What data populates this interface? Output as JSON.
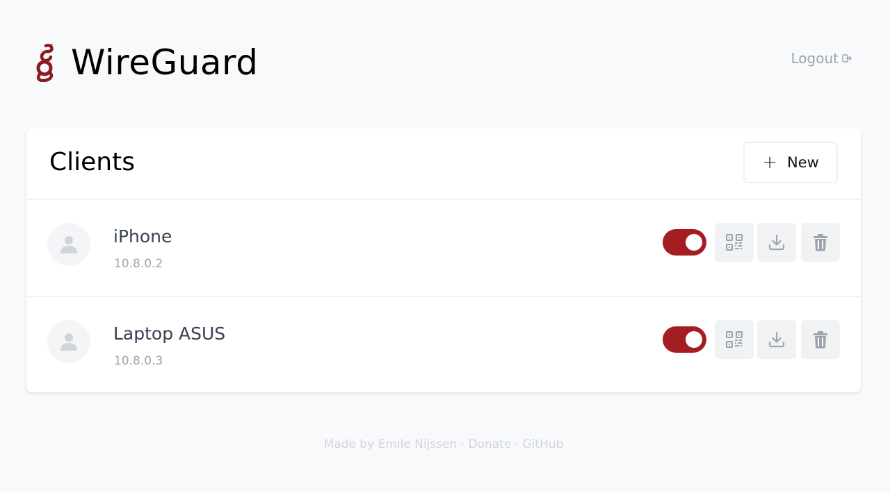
{
  "header": {
    "brand_title": "WireGuard",
    "logout_label": "Logout"
  },
  "clients_card": {
    "title": "Clients",
    "new_button_icon": "+",
    "new_button_label": "New",
    "clients": [
      {
        "name": "iPhone",
        "address": "10.8.0.2",
        "enabled": true
      },
      {
        "name": "Laptop ASUS",
        "address": "10.8.0.3",
        "enabled": true
      }
    ]
  },
  "footer": {
    "made_by": "Made by Emile Nijssen",
    "sep1": " · ",
    "donate": "Donate",
    "sep2": " · ",
    "github": "GitHub"
  },
  "colors": {
    "accent": "#a31d23",
    "background": "#f8f9fb",
    "muted_text": "#9ca3af"
  },
  "icons": [
    "wireguard-logo",
    "logout-icon",
    "plus-icon",
    "user-icon",
    "qrcode-icon",
    "download-icon",
    "trash-icon"
  ]
}
